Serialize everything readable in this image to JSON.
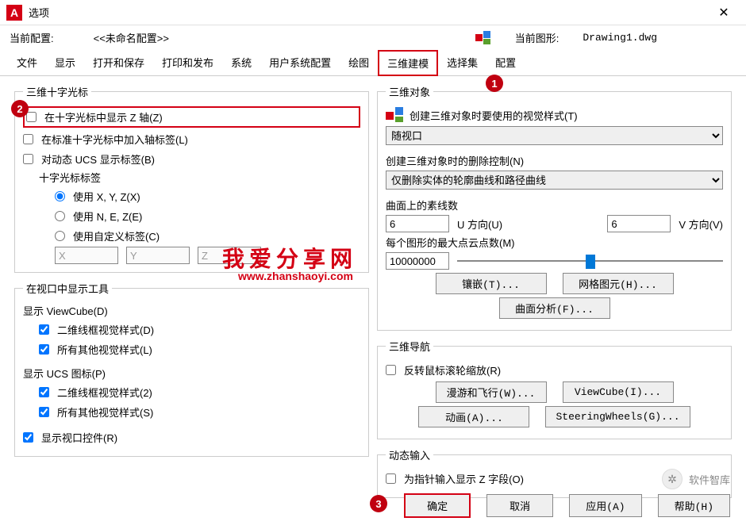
{
  "window": {
    "title": "选项",
    "app_letter": "A"
  },
  "topinfo": {
    "profile_label": "当前配置:",
    "profile_value": "<<未命名配置>>",
    "drawing_label": "当前图形:",
    "drawing_value": "Drawing1.dwg"
  },
  "tabs": [
    "文件",
    "显示",
    "打开和保存",
    "打印和发布",
    "系统",
    "用户系统配置",
    "绘图",
    "三维建模",
    "选择集",
    "配置"
  ],
  "active_tab_index": 7,
  "left": {
    "group1_title": "三维十字光标",
    "cb_show_z": "在十字光标中显示 Z 轴(Z)",
    "cb_axis_label": "在标准十字光标中加入轴标签(L)",
    "cb_dyn_ucs": "对动态 UCS 显示标签(B)",
    "crosshair_label_title": "十字光标标签",
    "rb_xyz": "使用 X, Y, Z(X)",
    "rb_nez": "使用 N, E, Z(E)",
    "rb_custom": "使用自定义标签(C)",
    "custom_x": "X",
    "custom_y": "Y",
    "custom_z": "Z",
    "group2_title": "在视口中显示工具",
    "viewcube_title": "显示 ViewCube(D)",
    "cb_vc_2d": "二维线框视觉样式(D)",
    "cb_vc_other": "所有其他视觉样式(L)",
    "ucs_title": "显示 UCS 图标(P)",
    "cb_ucs_2d": "二维线框视觉样式(2)",
    "cb_ucs_other": "所有其他视觉样式(S)",
    "cb_vp_ctrl": "显示视口控件(R)"
  },
  "right": {
    "group1_title": "三维对象",
    "visual_style_label": "创建三维对象时要使用的视觉样式(T)",
    "visual_style_value": "随视口",
    "delete_ctrl_label": "创建三维对象时的删除控制(N)",
    "delete_ctrl_value": "仅删除实体的轮廓曲线和路径曲线",
    "iso_label": "曲面上的素线数",
    "iso_u": "6",
    "iso_u_label": "U 方向(U)",
    "iso_v": "6",
    "iso_v_label": "V 方向(V)",
    "maxpts_label": "每个图形的最大点云点数(M)",
    "maxpts_value": "10000000",
    "btn_tess": "镶嵌(T)...",
    "btn_mesh": "网格图元(H)...",
    "btn_surf": "曲面分析(F)...",
    "group2_title": "三维导航",
    "cb_reverse": "反转鼠标滚轮缩放(R)",
    "btn_walkfly": "漫游和飞行(W)...",
    "btn_viewcube": "ViewCube(I)...",
    "btn_anim": "动画(A)...",
    "btn_steer": "SteeringWheels(G)...",
    "group3_title": "动态输入",
    "cb_zfield": "为指针输入显示 Z 字段(O)"
  },
  "footer": {
    "ok": "确定",
    "cancel": "取消",
    "apply": "应用(A)",
    "help": "帮助(H)"
  },
  "watermark": {
    "text1": "我爱分享网",
    "text2": "www.zhanshaoyi.com"
  },
  "brand": "软件智库"
}
